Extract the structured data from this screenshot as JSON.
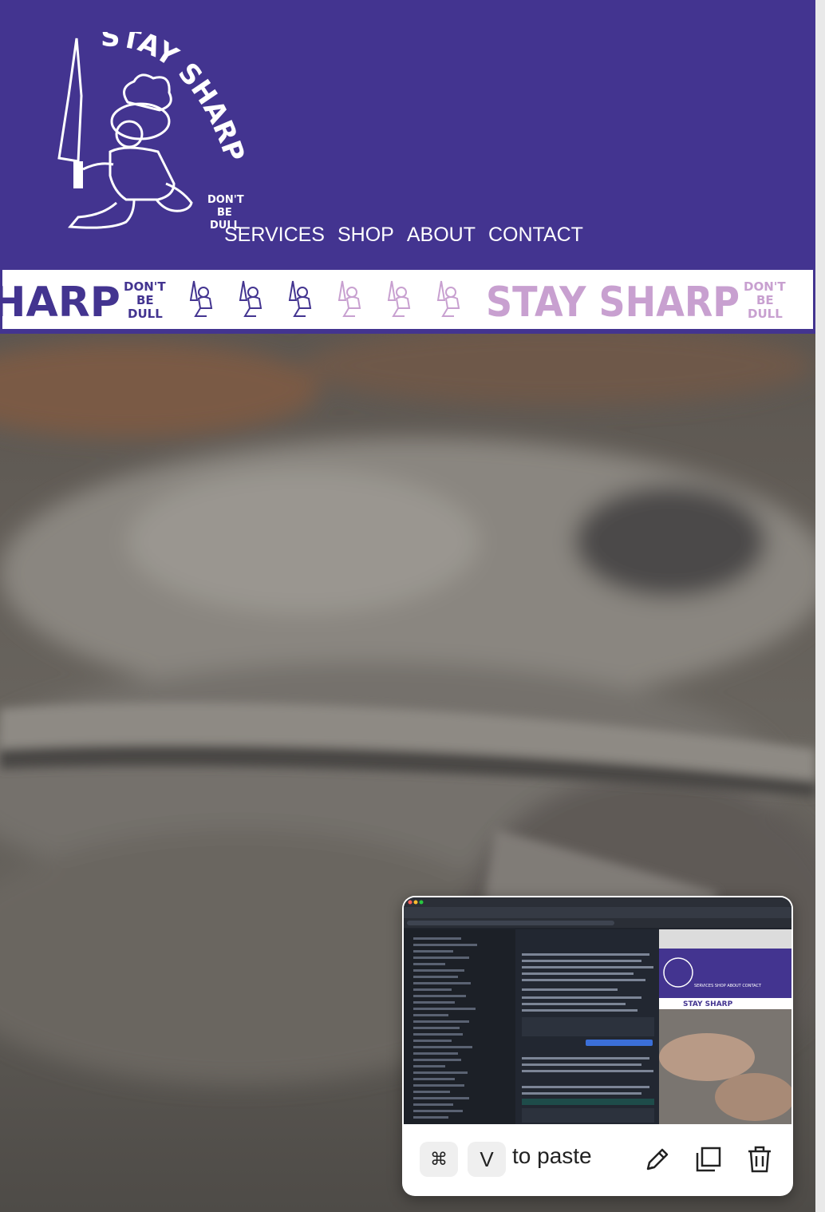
{
  "header": {
    "brand_arc": "STAY SHARP",
    "tagline": [
      "DON'T",
      "BE",
      "DULL"
    ],
    "nav": [
      "SERVICES",
      "SHOP",
      "ABOUT",
      "CONTACT"
    ],
    "bg_color": "#433490"
  },
  "marquee": {
    "brand_left": "HARP",
    "brand_right": "STAY SHARP",
    "tagline": [
      "DON'T",
      "BE",
      "DULL"
    ],
    "primary_color": "#433490",
    "secondary_color": "#c8a0d0"
  },
  "clipboard": {
    "cmd_key": "⌘",
    "v_key": "V",
    "paste_text": "to paste",
    "icons": [
      "edit-icon",
      "copy-icon",
      "trash-icon"
    ]
  },
  "thumbnail": {
    "site_brand": "STAY SHARP",
    "site_nav": "SERVICES SHOP ABOUT CONTACT"
  }
}
